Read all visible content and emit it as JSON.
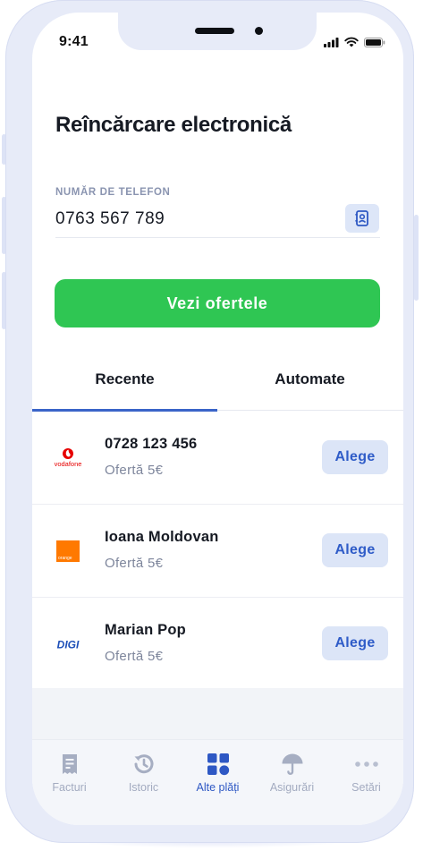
{
  "status_bar": {
    "time": "9:41"
  },
  "page": {
    "title": "Reîncărcare electronică"
  },
  "phone_field": {
    "label": "NUMĂR DE TELEFON",
    "value": "0763 567 789"
  },
  "cta": {
    "label": "Vezi ofertele"
  },
  "tabs": [
    {
      "label": "Recente",
      "active": true
    },
    {
      "label": "Automate",
      "active": false
    }
  ],
  "recents": [
    {
      "name": "0728 123 456",
      "offer": "Ofertă 5€",
      "operator": "Vodafone",
      "logo_text": "vodafone",
      "action": "Alege"
    },
    {
      "name": "Ioana Moldovan",
      "offer": "Ofertă 5€",
      "operator": "Orange",
      "logo_text": "orange",
      "action": "Alege"
    },
    {
      "name": "Marian Pop",
      "offer": "Ofertă 5€",
      "operator": "Digi",
      "logo_text": "DIGI",
      "action": "Alege"
    }
  ],
  "tab_bar": [
    {
      "label": "Facturi",
      "icon": "receipt-icon",
      "active": false
    },
    {
      "label": "Istoric",
      "icon": "history-icon",
      "active": false
    },
    {
      "label": "Alte plăți",
      "icon": "grid-icon",
      "active": true
    },
    {
      "label": "Asigurări",
      "icon": "umbrella-icon",
      "active": false
    },
    {
      "label": "Setări",
      "icon": "more-dots-icon",
      "active": false
    }
  ],
  "colors": {
    "accent": "#2fc653",
    "primary": "#3a64c8",
    "vodafone": "#e60000",
    "orange": "#ff7900",
    "digi": "#1d4fb8"
  }
}
